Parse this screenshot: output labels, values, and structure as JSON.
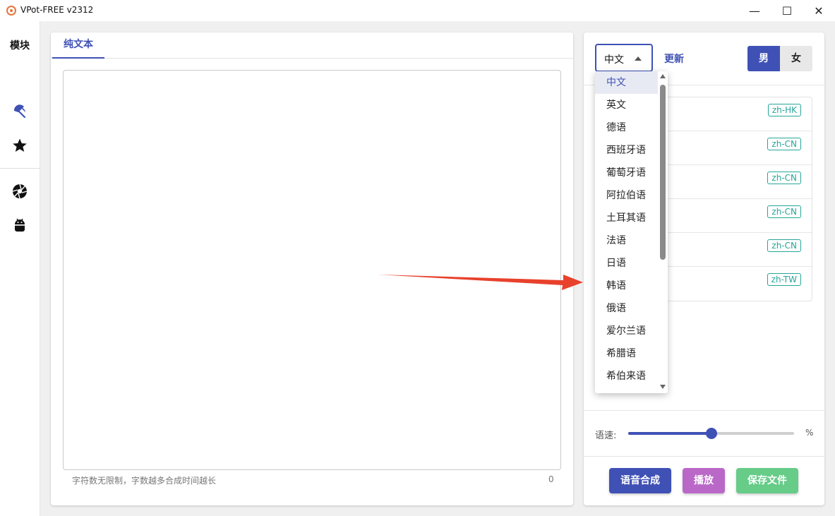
{
  "window": {
    "title": "VPot-FREE v2312",
    "minimize_glyph": "—",
    "maximize_glyph": "☐",
    "close_glyph": "✕"
  },
  "sidebar": {
    "title": "模块",
    "icons": [
      "umbrella-icon",
      "star-icon",
      "aperture-icon",
      "android-icon"
    ],
    "accent": "#3f51b5"
  },
  "editor": {
    "tab_label": "纯文本",
    "textarea_value": "",
    "hint": "字符数无限制，字数越多合成时间越长",
    "char_count": "0"
  },
  "voice_panel": {
    "language_selected": "中文",
    "update_label": "更新",
    "gender": {
      "male_label": "男",
      "female_label": "女",
      "selected": "男"
    },
    "voices": [
      {
        "tag": "zh-HK"
      },
      {
        "tag": "zh-CN"
      },
      {
        "tag": "zh-CN"
      },
      {
        "tag": "zh-CN"
      },
      {
        "tag": "zh-CN"
      },
      {
        "tag": "zh-TW"
      }
    ],
    "speed_label": "语速:",
    "speed_unit": "%",
    "speed_fraction": 0.5,
    "buttons": {
      "synthesize": "语音合成",
      "play": "播放",
      "save": "保存文件"
    }
  },
  "language_dropdown": {
    "options": [
      "中文",
      "英文",
      "德语",
      "西班牙语",
      "葡萄牙语",
      "阿拉伯语",
      "土耳其语",
      "法语",
      "日语",
      "韩语",
      "俄语",
      "爱尔兰语",
      "希腊语",
      "希伯来语"
    ],
    "selected_index": 0
  },
  "colors": {
    "primary": "#3f51b5",
    "play": "#ba68c8",
    "save": "#66cc88",
    "tag": "#26a69a",
    "annotation_arrow": "#e8412c"
  }
}
